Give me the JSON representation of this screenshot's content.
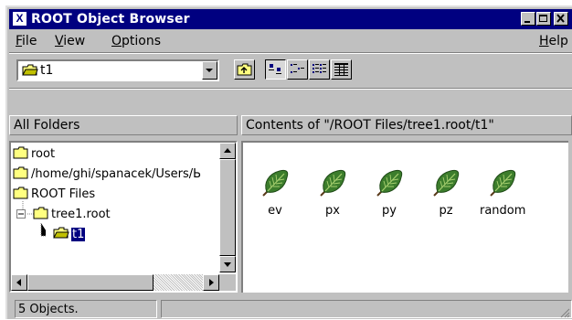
{
  "window": {
    "app_icon": "X",
    "title": "ROOT Object Browser",
    "controls": [
      "minimize",
      "maximize",
      "close"
    ]
  },
  "menu": {
    "file": {
      "mnemonic": "F",
      "rest": "ile"
    },
    "view": {
      "mnemonic": "V",
      "rest": "iew"
    },
    "options": {
      "mnemonic": "O",
      "rest": "ptions"
    },
    "help": {
      "mnemonic": "H",
      "rest": "elp"
    }
  },
  "toolbar": {
    "location_value": "t1",
    "buttons": [
      "up-one-level-icon",
      "large-icons-icon",
      "small-icons-icon",
      "list-icon",
      "details-icon"
    ]
  },
  "headers": {
    "folders": "All Folders",
    "contents": "Contents of \"/ROOT Files/tree1.root/t1\""
  },
  "tree": {
    "items": [
      {
        "label": "root"
      },
      {
        "label": "/home/ghi/spanacek/Users/Ь"
      },
      {
        "label": "ROOT Files"
      },
      {
        "label": "tree1.root"
      },
      {
        "label": "t1"
      }
    ]
  },
  "contents": {
    "objects": [
      {
        "label": "ev",
        "icon": "leaf-icon"
      },
      {
        "label": "px",
        "icon": "leaf-icon"
      },
      {
        "label": "py",
        "icon": "leaf-icon"
      },
      {
        "label": "pz",
        "icon": "leaf-icon"
      },
      {
        "label": "random",
        "icon": "leaf-icon"
      }
    ]
  },
  "status": {
    "count_text": "5 Objects.",
    "secondary": ""
  },
  "colors": {
    "title_bar": "#000080",
    "face": "#c0c0c0",
    "selection": "#000080",
    "folder": "#ffff80",
    "leaf": "#3c7d2c"
  }
}
